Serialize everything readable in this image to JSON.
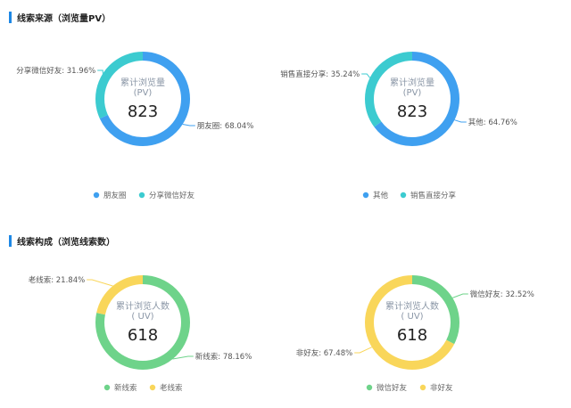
{
  "sections": [
    {
      "title": "线索来源（浏览量PV）"
    },
    {
      "title": "线索构成（浏览线索数）"
    }
  ],
  "chart_data": [
    {
      "type": "pie",
      "donut": true,
      "center_label_lines": [
        "累计浏览量",
        "(PV)"
      ],
      "center_value": "823",
      "slices": [
        {
          "name": "朋友圈",
          "value": 68.04,
          "label": "朋友圈: 68.04%",
          "color": "#3fa0f0"
        },
        {
          "name": "分享微信好友",
          "value": 31.96,
          "label": "分享微信好友: 31.96%",
          "color": "#3ccbd0"
        }
      ],
      "legend": [
        "朋友圈",
        "分享微信好友"
      ],
      "legend_position": "bottom"
    },
    {
      "type": "pie",
      "donut": true,
      "center_label_lines": [
        "累计浏览量",
        "(PV)"
      ],
      "center_value": "823",
      "slices": [
        {
          "name": "其他",
          "value": 64.76,
          "label": "其他: 64.76%",
          "color": "#3fa0f0"
        },
        {
          "name": "销售直接分享",
          "value": 35.24,
          "label": "销售直接分享: 35.24%",
          "color": "#3ccbd0"
        }
      ],
      "legend": [
        "其他",
        "销售直接分享"
      ],
      "legend_position": "bottom"
    },
    {
      "type": "pie",
      "donut": true,
      "center_label_lines": [
        "累计浏览人数",
        "( UV)"
      ],
      "center_value": "618",
      "slices": [
        {
          "name": "新线索",
          "value": 78.16,
          "label": "新线索: 78.16%",
          "color": "#6ed38a"
        },
        {
          "name": "老线索",
          "value": 21.84,
          "label": "老线索: 21.84%",
          "color": "#f9d65a"
        }
      ],
      "legend": [
        "新线索",
        "老线索"
      ],
      "legend_position": "bottom"
    },
    {
      "type": "pie",
      "donut": true,
      "center_label_lines": [
        "累计浏览人数",
        "( UV)"
      ],
      "center_value": "618",
      "slices": [
        {
          "name": "微信好友",
          "value": 32.52,
          "label": "微信好友: 32.52%",
          "color": "#6ed38a"
        },
        {
          "name": "非好友",
          "value": 67.48,
          "label": "非好友: 67.48%",
          "color": "#f9d65a"
        }
      ],
      "legend": [
        "微信好友",
        "非好友"
      ],
      "legend_position": "bottom"
    }
  ]
}
